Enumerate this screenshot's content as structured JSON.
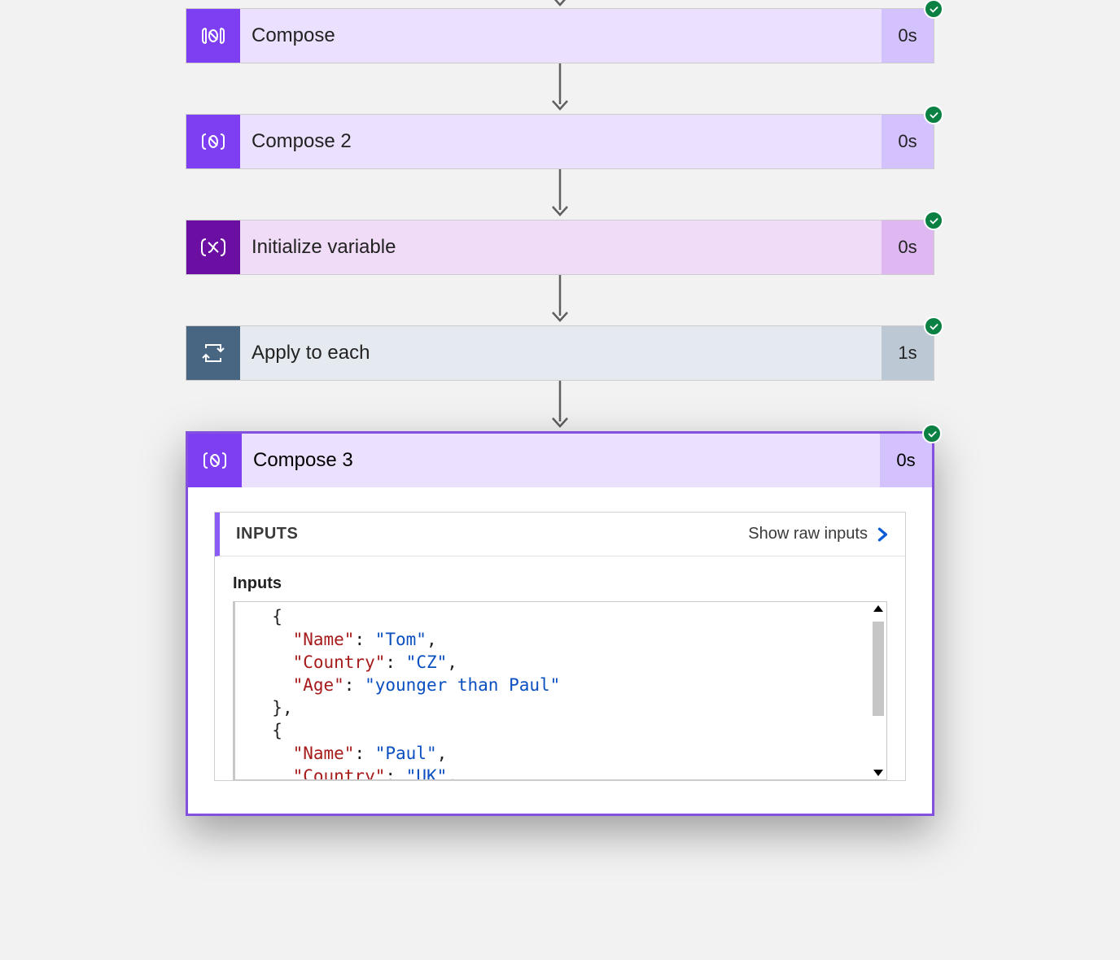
{
  "steps": {
    "compose": {
      "label": "Compose",
      "duration": "0s"
    },
    "compose2": {
      "label": "Compose 2",
      "duration": "0s"
    },
    "initvar": {
      "label": "Initialize variable",
      "duration": "0s"
    },
    "applyeach": {
      "label": "Apply to each",
      "duration": "1s"
    },
    "compose3": {
      "label": "Compose 3",
      "duration": "0s"
    }
  },
  "detail": {
    "panel_title": "INPUTS",
    "raw_link": "Show raw inputs",
    "sub_label": "Inputs",
    "json_visible": [
      {
        "indent": 1,
        "type": "brace",
        "text": "{"
      },
      {
        "indent": 2,
        "type": "kv",
        "key": "Name",
        "value": "Tom",
        "comma": true
      },
      {
        "indent": 2,
        "type": "kv",
        "key": "Country",
        "value": "CZ",
        "comma": true
      },
      {
        "indent": 2,
        "type": "kv",
        "key": "Age",
        "value": "younger than Paul",
        "comma": false
      },
      {
        "indent": 1,
        "type": "brace",
        "text": "},"
      },
      {
        "indent": 1,
        "type": "brace",
        "text": "{"
      },
      {
        "indent": 2,
        "type": "kv",
        "key": "Name",
        "value": "Paul",
        "comma": true
      },
      {
        "indent": 2,
        "type": "kv",
        "key": "Country",
        "value": "UK",
        "comma": true
      }
    ]
  }
}
